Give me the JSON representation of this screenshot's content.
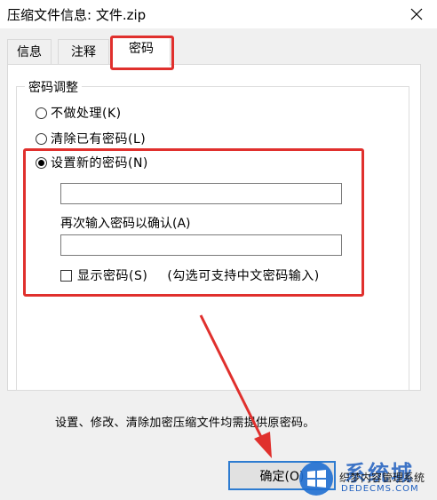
{
  "window": {
    "title": "压缩文件信息: 文件.zip",
    "close_label": "✕"
  },
  "tabs": [
    {
      "label": "信息",
      "active": false
    },
    {
      "label": "注释",
      "active": false
    },
    {
      "label": "密码",
      "active": true
    }
  ],
  "password_group": {
    "title": "密码调整",
    "options": [
      {
        "label": "不做处理(K)",
        "checked": false
      },
      {
        "label": "清除已有密码(L)",
        "checked": false
      },
      {
        "label": "设置新的密码(N)",
        "checked": true
      }
    ],
    "new_password": {
      "value": ""
    },
    "confirm_label": "再次输入密码以确认(A)",
    "confirm_password": {
      "value": ""
    },
    "show_password": {
      "label": "显示密码(S)",
      "checked": false
    },
    "show_password_hint": "(勾选可支持中文密码输入)"
  },
  "footer_note": "设置、修改、清除加密压缩文件均需提供原密码。",
  "ok_button": {
    "label": "确定(O)"
  },
  "watermark": {
    "big_text": "系统城",
    "sub_text": "织梦内容管理系统",
    "url_text": "DEDECMS.COM"
  },
  "colors": {
    "highlight_red": "#e0302d",
    "focus_blue": "#2d7bd0",
    "dialog_gray": "#f0f0f0"
  }
}
